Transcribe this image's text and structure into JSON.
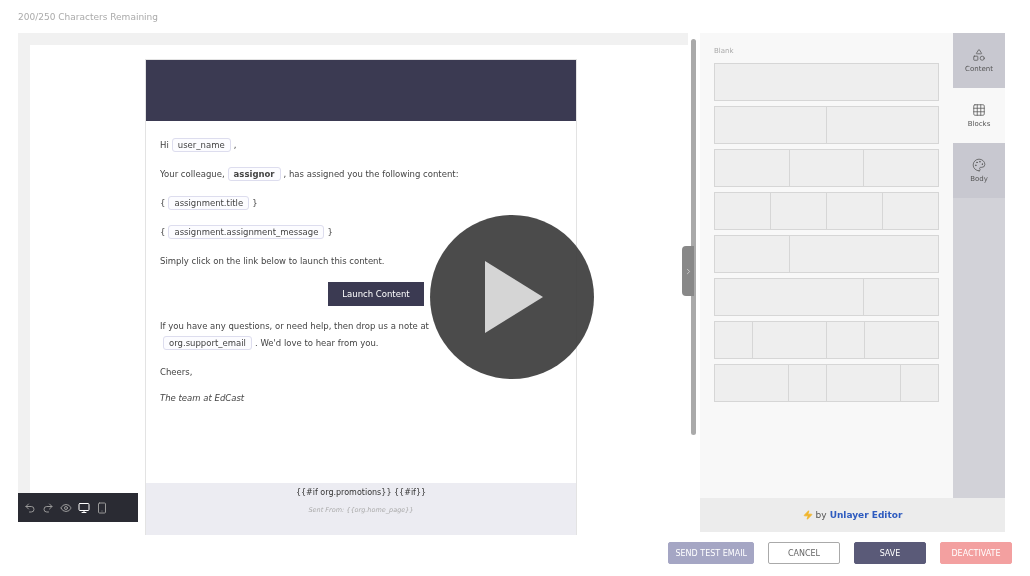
{
  "counter": "200/250 Characters Remaining",
  "email": {
    "paragraphs": [
      [
        {
          "kind": "text",
          "text": "Hi"
        },
        {
          "kind": "tag",
          "text": "user_name",
          "bold": false
        },
        {
          "kind": "text",
          "text": ","
        }
      ],
      [
        {
          "kind": "text",
          "text": "Your colleague,"
        },
        {
          "kind": "tag",
          "text": "assignor",
          "bold": true
        },
        {
          "kind": "text",
          "text": ", has assigned you the following content:"
        }
      ],
      [
        {
          "kind": "text",
          "text": "{"
        },
        {
          "kind": "tag",
          "text": "assignment.title",
          "bold": false
        },
        {
          "kind": "text",
          "text": "}"
        }
      ],
      [
        {
          "kind": "text",
          "text": "{"
        },
        {
          "kind": "tag",
          "text": "assignment.assignment_message",
          "bold": false
        },
        {
          "kind": "text",
          "text": "}"
        }
      ],
      [
        {
          "kind": "text",
          "text": "Simply click on the link below to launch this content."
        }
      ]
    ],
    "button": "Launch Content",
    "help": [
      {
        "kind": "text",
        "text": "If you have any questions, or need help, then drop us a note at"
      },
      {
        "kind": "break"
      },
      {
        "kind": "tag",
        "text": "org.support_email",
        "bold": false
      },
      {
        "kind": "text",
        "text": ". We'd love to hear from you."
      }
    ],
    "closing": "Cheers,",
    "signature": "The team at EdCast",
    "footer_line": "{{#if org.promotions}} {{#if}}",
    "sent_from": "Sent From: {{org.home_page}}"
  },
  "toolbar": [
    {
      "kind": "undo",
      "selected": false
    },
    {
      "kind": "redo",
      "selected": false
    },
    {
      "kind": "preview",
      "selected": false
    },
    {
      "kind": "desktop",
      "selected": true
    },
    {
      "kind": "mobile",
      "selected": false
    }
  ],
  "blocks": {
    "title": "Blank",
    "rows": [
      {
        "kind": "full"
      },
      {
        "kind": "halves"
      },
      {
        "kind": "thirds"
      },
      {
        "kind": "quarters"
      },
      {
        "kind": "narrow-wide"
      },
      {
        "kind": "wide-narrow"
      },
      {
        "kind": "alternating"
      },
      {
        "kind": "alternating-reverse"
      }
    ]
  },
  "tabs": [
    {
      "kind": "content",
      "label": "Content",
      "selected": false
    },
    {
      "kind": "blocks",
      "label": "Blocks",
      "selected": true
    },
    {
      "kind": "body",
      "label": "Body",
      "selected": false
    }
  ],
  "branding": {
    "prefix": "by",
    "name": "Unlayer Editor"
  },
  "actions": [
    {
      "kind": "test",
      "label": "SEND TEST EMAIL"
    },
    {
      "kind": "cancel",
      "label": "CANCEL"
    },
    {
      "kind": "save",
      "label": "SAVE"
    },
    {
      "kind": "deactivate",
      "label": "DEACTIVATE"
    }
  ]
}
